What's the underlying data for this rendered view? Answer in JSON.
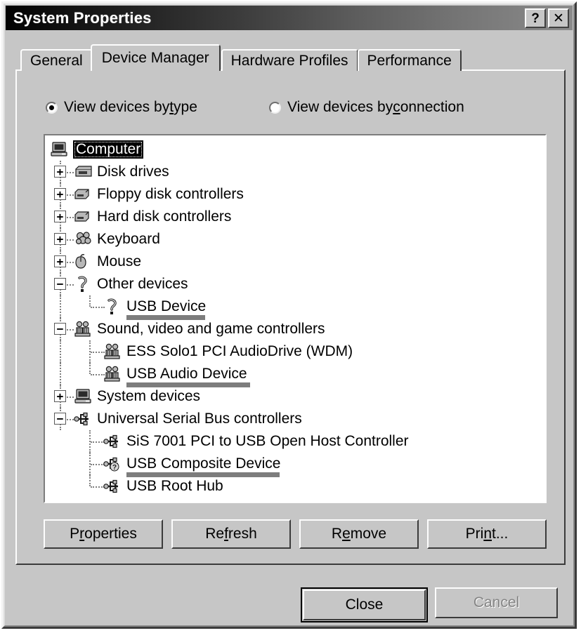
{
  "window": {
    "title": "System Properties",
    "help_button": "?",
    "close_button": "✕"
  },
  "tabs": [
    {
      "label": "General",
      "active": false
    },
    {
      "label": "Device Manager",
      "active": true
    },
    {
      "label": "Hardware Profiles",
      "active": false
    },
    {
      "label": "Performance",
      "active": false
    }
  ],
  "view_options": {
    "by_type": {
      "label_pre": "View devices by ",
      "accel": "t",
      "label_post": "ype",
      "selected": true
    },
    "by_connection": {
      "label_pre": "View devices by ",
      "accel": "c",
      "label_post": "onnection",
      "selected": false
    }
  },
  "device_tree": {
    "nodes": [
      {
        "label": "Computer",
        "depth": 0,
        "state": "root",
        "icon": "computer-icon",
        "selected": true,
        "highlighted": false
      },
      {
        "label": "Disk drives",
        "depth": 1,
        "state": "collapsed",
        "icon": "disk-drive-icon",
        "selected": false,
        "highlighted": false
      },
      {
        "label": "Floppy disk controllers",
        "depth": 1,
        "state": "collapsed",
        "icon": "controller-icon",
        "selected": false,
        "highlighted": false
      },
      {
        "label": "Hard disk controllers",
        "depth": 1,
        "state": "collapsed",
        "icon": "controller-icon",
        "selected": false,
        "highlighted": false
      },
      {
        "label": "Keyboard",
        "depth": 1,
        "state": "collapsed",
        "icon": "keyboard-icon",
        "selected": false,
        "highlighted": false
      },
      {
        "label": "Mouse",
        "depth": 1,
        "state": "collapsed",
        "icon": "mouse-icon",
        "selected": false,
        "highlighted": false
      },
      {
        "label": "Other devices",
        "depth": 1,
        "state": "expanded",
        "icon": "unknown-device-icon",
        "selected": false,
        "highlighted": false
      },
      {
        "label": "USB Device",
        "depth": 2,
        "state": "leaf",
        "icon": "unknown-device-icon",
        "selected": false,
        "highlighted": true
      },
      {
        "label": "Sound, video and game controllers",
        "depth": 1,
        "state": "expanded",
        "icon": "sound-icon",
        "selected": false,
        "highlighted": false
      },
      {
        "label": "ESS Solo1 PCI AudioDrive (WDM)",
        "depth": 2,
        "state": "leaf",
        "icon": "sound-icon",
        "selected": false,
        "highlighted": false
      },
      {
        "label": "USB Audio Device",
        "depth": 2,
        "state": "leaf",
        "icon": "sound-icon",
        "selected": false,
        "highlighted": true
      },
      {
        "label": "System devices",
        "depth": 1,
        "state": "collapsed",
        "icon": "computer-icon",
        "selected": false,
        "highlighted": false
      },
      {
        "label": "Universal Serial Bus controllers",
        "depth": 1,
        "state": "expanded",
        "icon": "usb-icon",
        "selected": false,
        "highlighted": false
      },
      {
        "label": "SiS 7001 PCI to USB Open Host Controller",
        "depth": 2,
        "state": "leaf",
        "icon": "usb-icon",
        "selected": false,
        "highlighted": false
      },
      {
        "label": "USB Composite Device",
        "depth": 2,
        "state": "leaf",
        "icon": "usb-question-icon",
        "selected": false,
        "highlighted": true
      },
      {
        "label": "USB Root Hub",
        "depth": 2,
        "state": "leaf",
        "icon": "usb-icon",
        "selected": false,
        "highlighted": false
      }
    ],
    "expand_glyph": "+",
    "collapse_glyph": "−"
  },
  "action_buttons": [
    {
      "pre": "P",
      "accel": "r",
      "post": "operties",
      "enabled": true
    },
    {
      "pre": "Re",
      "accel": "f",
      "post": "resh",
      "enabled": true
    },
    {
      "pre": "R",
      "accel": "e",
      "post": "move",
      "enabled": true
    },
    {
      "pre": "Pri",
      "accel": "n",
      "post": "t...",
      "enabled": true
    }
  ],
  "dialog_buttons": [
    {
      "label": "Close",
      "default": true,
      "enabled": true
    },
    {
      "label": "Cancel",
      "default": false,
      "enabled": false
    }
  ],
  "colors": {
    "face": "#c6c6c6",
    "titlebar_start": "#020202",
    "titlebar_end": "#8b8b8b",
    "selection": "#000000",
    "highlighter": "#7d7d7d",
    "tree_background": "#ffffff"
  }
}
